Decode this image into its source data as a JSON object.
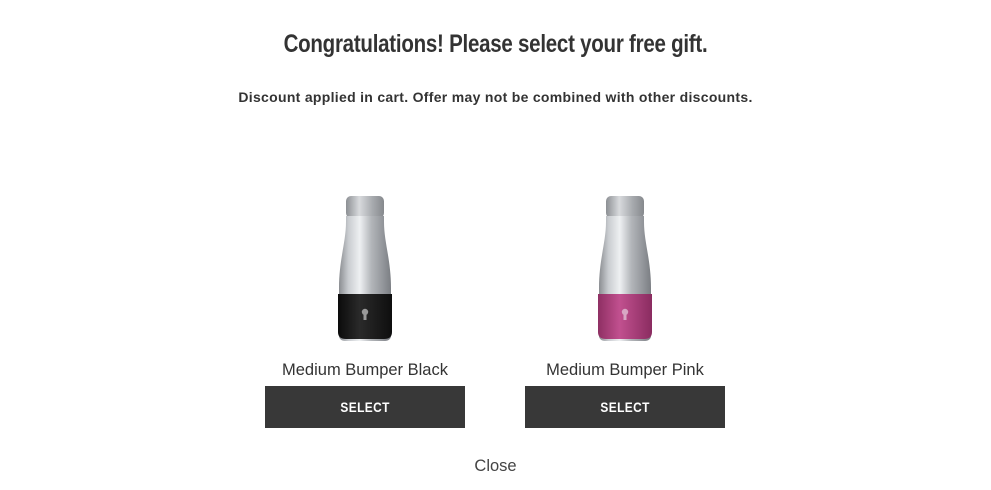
{
  "modal": {
    "title": "Congratulations! Please select your free gift.",
    "subtitle": "Discount applied in cart. Offer may not be combined with other discounts.",
    "close_label": "Close"
  },
  "products": [
    {
      "name": "Medium Bumper Black",
      "button_label": "SELECT",
      "bumper_color": "#151515"
    },
    {
      "name": "Medium Bumper Pink",
      "button_label": "SELECT",
      "bumper_color": "#b0407e"
    }
  ],
  "colors": {
    "button_bg": "#383838",
    "text": "#333333"
  }
}
